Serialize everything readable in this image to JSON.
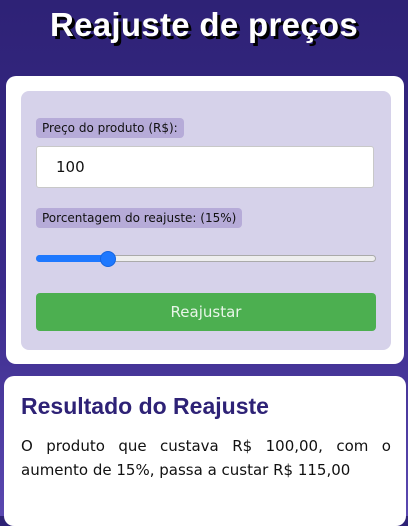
{
  "page": {
    "title": "Reajuste de preços"
  },
  "form": {
    "price_label": "Preço do produto (R$):",
    "price_value": "100",
    "percent_label": "Porcentagem do reajuste: (15%)",
    "percent_value": 15,
    "percent_min": 0,
    "percent_max": 100,
    "submit_label": "Reajustar"
  },
  "result": {
    "heading": "Resultado do Reajuste",
    "text": "O produto que custava R$ 100,00, com o aumento de 15%, passa a custar R$ 115,00"
  },
  "colors": {
    "background": "#2e2276",
    "button": "#4caf50",
    "slider_accent": "#1e78ff",
    "heading": "#2e2276"
  }
}
